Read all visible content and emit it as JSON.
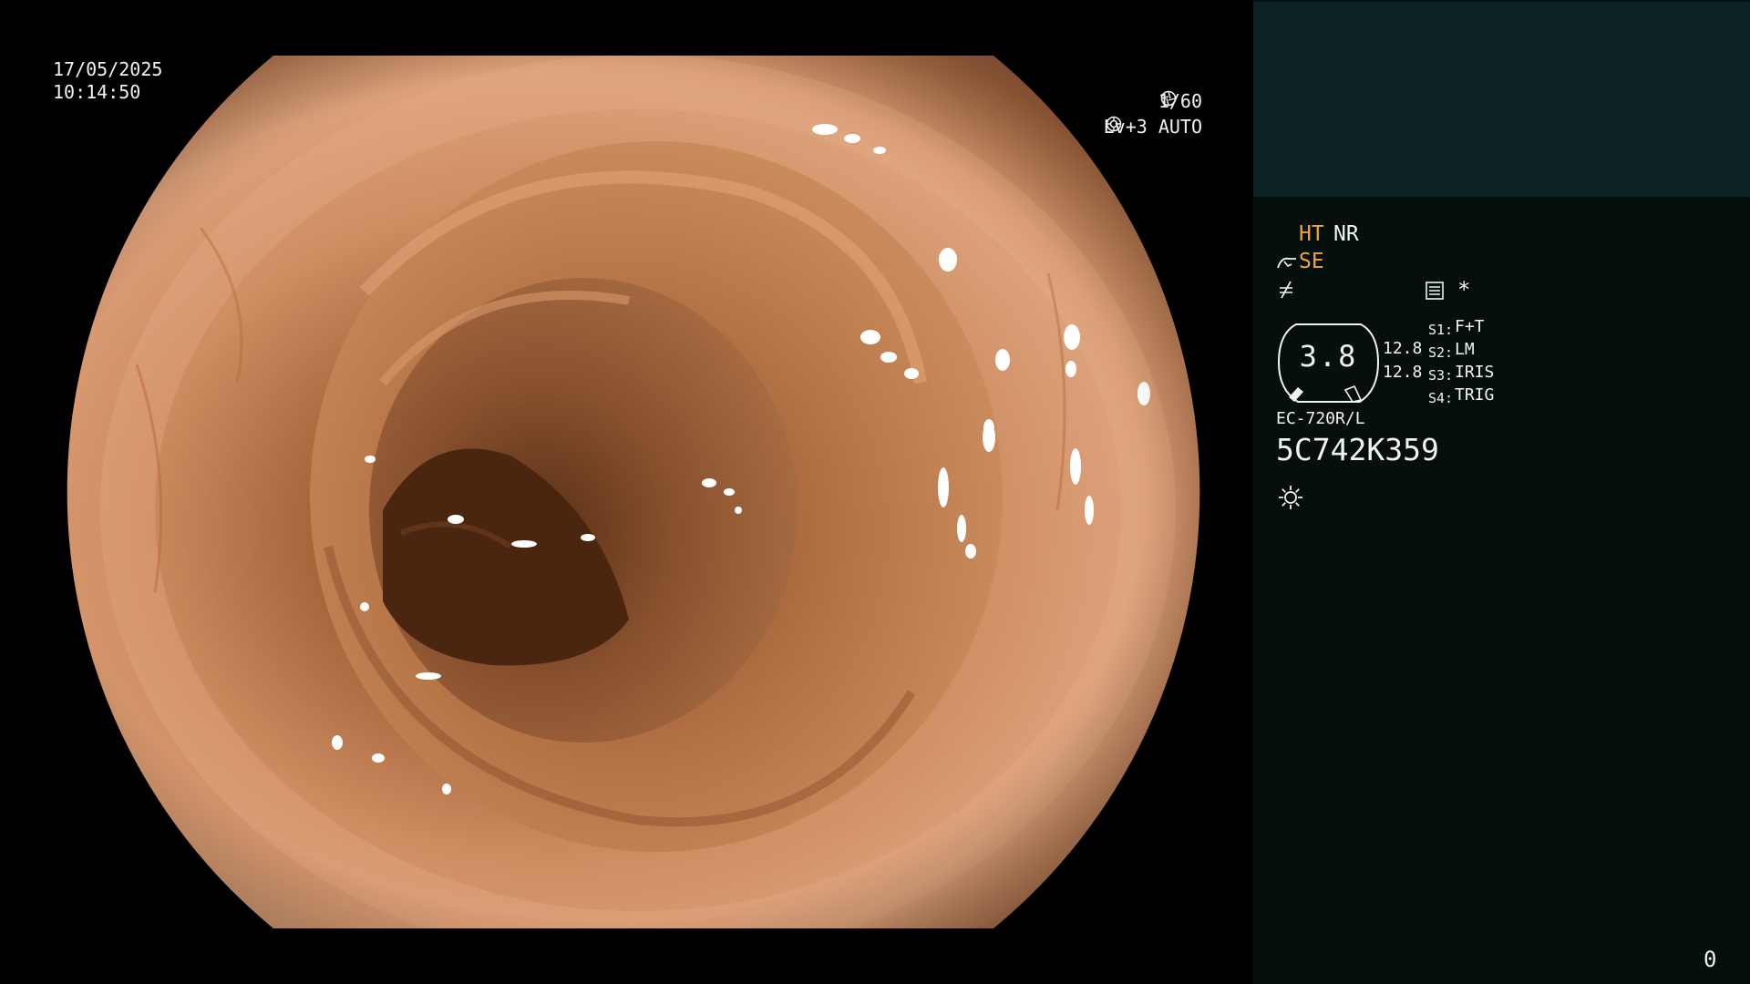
{
  "overlay": {
    "date": "17/05/2025",
    "time": "10:14:50",
    "shutter": "1/60",
    "shutter_icon": "shutter-icon",
    "level": "Lv+3",
    "exposure_mode": "AUTO",
    "exposure_icon": "auto-exposure-icon"
  },
  "panel": {
    "modes": {
      "ht": "HT",
      "nr": "NR",
      "se": "SE",
      "ht_color": "#f0a531",
      "se_color": "#f0a531"
    },
    "icons": {
      "scope": "scope-icon",
      "freeze": "freeze-icon",
      "record": "record-icon",
      "light": "light-source-icon"
    },
    "asterisk": "*",
    "gauge_value": "3.8",
    "value_1": "12.8",
    "value_2": "12.8",
    "switches": [
      {
        "key": "S1:",
        "value": "F+T"
      },
      {
        "key": "S2:",
        "value": "LM"
      },
      {
        "key": "S3:",
        "value": "IRIS"
      },
      {
        "key": "S4:",
        "value": "TRIG"
      }
    ],
    "scope_model": "EC-720R/L",
    "scope_serial": "5C742K359",
    "page_counter": "0"
  },
  "colors": {
    "panel_background": "#050f0d",
    "panel_header": "#0c2224",
    "accent": "#f0a531",
    "text": "#f2f2f2"
  }
}
